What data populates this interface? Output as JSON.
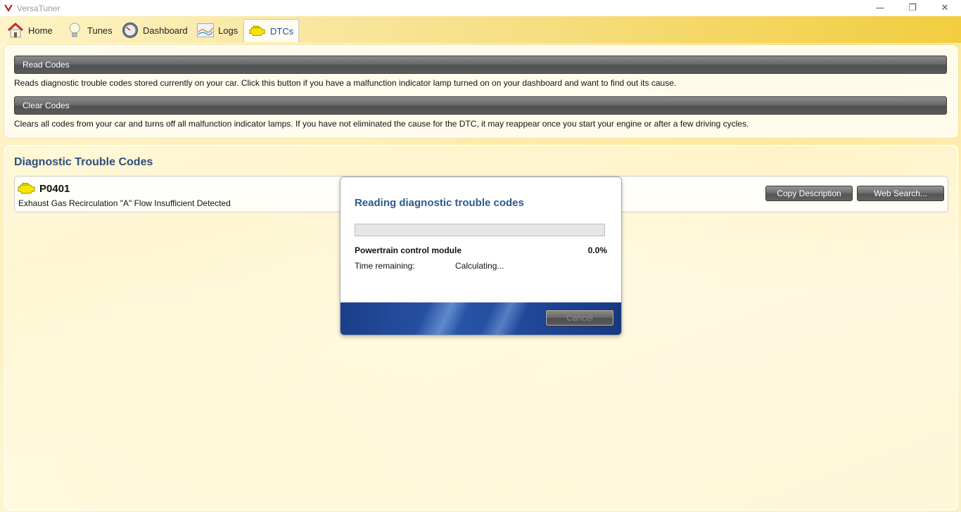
{
  "window": {
    "title": "VersaTuner",
    "logo_icon": "versatuner-logo-icon",
    "controls": {
      "minimize": "—",
      "restore": "❐",
      "close": "✕"
    }
  },
  "tabs": [
    {
      "label": "Home",
      "icon": "home-icon"
    },
    {
      "label": "Tunes",
      "icon": "lightbulb-icon"
    },
    {
      "label": "Dashboard",
      "icon": "gauge-icon"
    },
    {
      "label": "Logs",
      "icon": "chart-icon"
    },
    {
      "label": "DTCs",
      "icon": "engine-icon",
      "active": true
    }
  ],
  "actions": {
    "read": {
      "label": "Read Codes",
      "description": "Reads diagnostic trouble codes stored currently on your car. Click this button if you have a malfunction indicator lamp turned on on your dashboard and want to find out its cause."
    },
    "clear": {
      "label": "Clear Codes",
      "description": "Clears all codes from your car and turns off all malfunction indicator lamps. If you have not eliminated the cause for the DTC, it may reappear once you start your engine or after a few driving cycles."
    }
  },
  "dtc_section": {
    "title": "Diagnostic Trouble Codes",
    "items": [
      {
        "code": "P0401",
        "description": "Exhaust Gas Recirculation \"A\" Flow Insufficient Detected",
        "copy_label": "Copy Description",
        "search_label": "Web Search..."
      }
    ]
  },
  "dialog": {
    "title": "Reading diagnostic trouble codes",
    "progress_fraction": 0.0,
    "module": "Powertrain control module",
    "percent": "0.0%",
    "time_label": "Time remaining:",
    "time_value": "Calculating...",
    "cancel_label": "Cancel"
  },
  "colors": {
    "accent_title": "#2d4f7c",
    "active_tab_text": "#1f4fa0",
    "check_engine_yellow": "#f5e600"
  }
}
